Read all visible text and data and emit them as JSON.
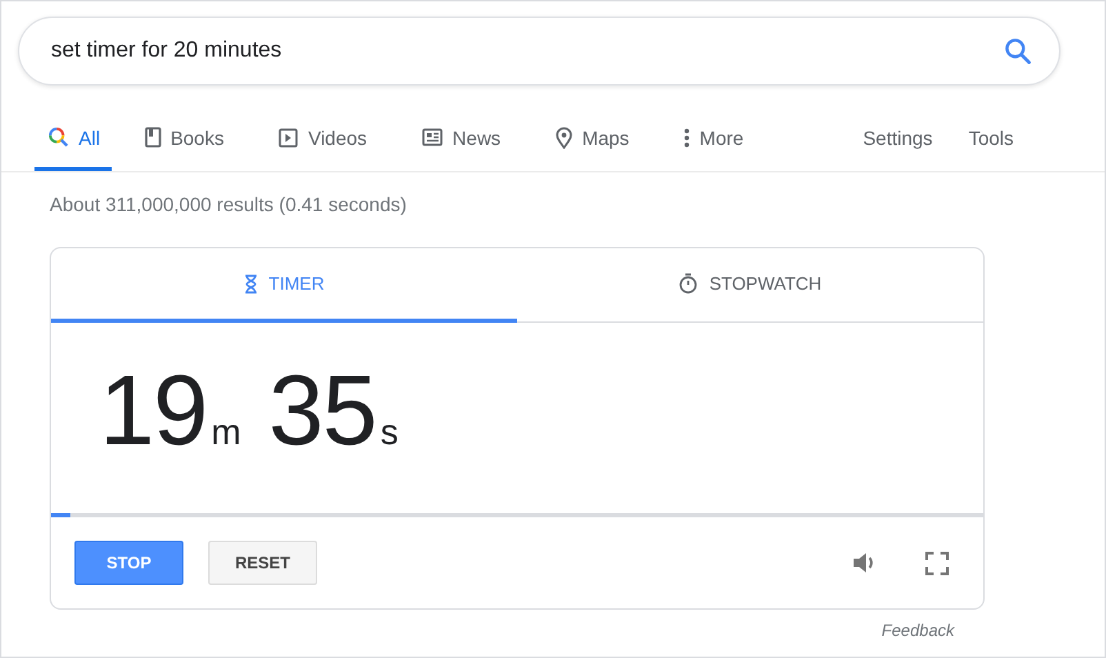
{
  "search": {
    "value": "set timer for 20 minutes"
  },
  "nav_tabs": [
    {
      "label": "All",
      "kind": "all",
      "selected": true
    },
    {
      "label": "Books",
      "kind": "book",
      "selected": false
    },
    {
      "label": "Videos",
      "kind": "video",
      "selected": false
    },
    {
      "label": "News",
      "kind": "news",
      "selected": false
    },
    {
      "label": "Maps",
      "kind": "map",
      "selected": false
    },
    {
      "label": "More",
      "kind": "more",
      "selected": false
    }
  ],
  "nav_tools": [
    "Settings",
    "Tools"
  ],
  "result_stats": "About 311,000,000 results (0.41 seconds)",
  "timer_card": {
    "tabs": [
      {
        "label": "TIMER",
        "kind": "hourglass",
        "selected": true
      },
      {
        "label": "STOPWATCH",
        "kind": "stopwatch",
        "selected": false
      }
    ],
    "minutes": "19",
    "minutes_unit": "m",
    "seconds": "35",
    "seconds_unit": "s",
    "progress": {
      "level": 0.02
    },
    "buttons": [
      {
        "label": "STOP",
        "kind": "primary"
      },
      {
        "label": "RESET",
        "kind": "secondary"
      }
    ]
  },
  "feedback": "Feedback"
}
